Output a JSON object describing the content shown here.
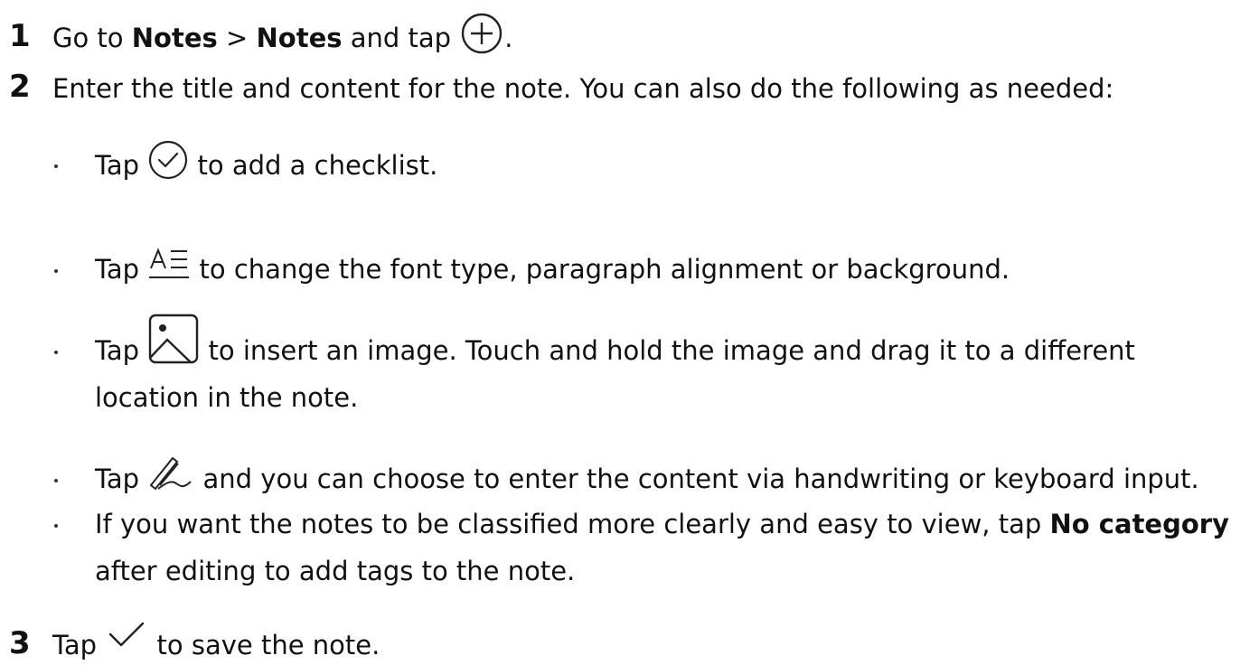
{
  "steps": [
    {
      "number": "1",
      "text_prefix": "Go to ",
      "bold_a": "Notes",
      "separator": " > ",
      "bold_b": "Notes",
      "text_suffix": " and tap ",
      "icon": "plus-circle-icon",
      "end": "."
    },
    {
      "number": "2",
      "text": "Enter the title and content for the note. You can also do the following as needed:"
    },
    {
      "number": "3",
      "text_prefix": "Tap ",
      "icon": "checkmark-icon",
      "text_suffix": " to save the note."
    }
  ],
  "bullets": [
    {
      "prefix": "Tap ",
      "icon": "checklist-circle-icon",
      "suffix": " to add a checklist."
    },
    {
      "prefix": "Tap ",
      "icon": "text-format-icon",
      "suffix": " to change the font type, paragraph alignment or background."
    },
    {
      "prefix": "Tap ",
      "icon": "image-icon",
      "suffix": " to insert an image. Touch and hold the image and drag it to a different",
      "continuation": "location in the note."
    },
    {
      "prefix": "Tap ",
      "icon": "handwriting-icon",
      "suffix": " and you can choose to enter the content via handwriting or keyboard input."
    },
    {
      "prefix": "If you want the notes to be classified more clearly and easy to view, tap ",
      "bold": "No category",
      "continuation": "after editing to add tags to the note."
    }
  ],
  "colors": {
    "text": "#111111",
    "icon_stroke": "#222222"
  }
}
